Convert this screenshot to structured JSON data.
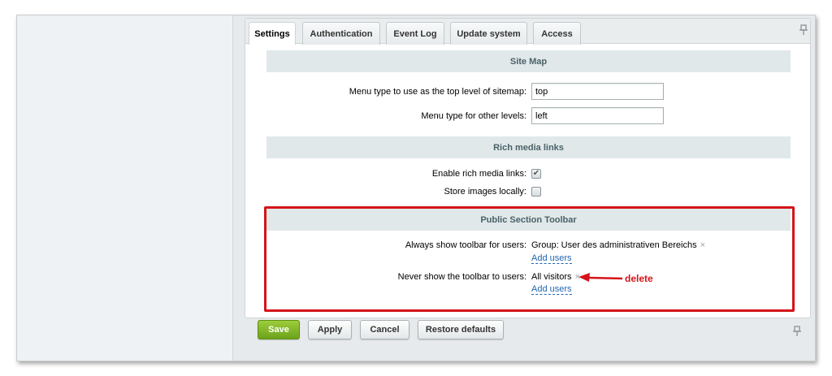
{
  "tabs": [
    {
      "label": "Settings",
      "active": true
    },
    {
      "label": "Authentication",
      "active": false
    },
    {
      "label": "Event Log",
      "active": false
    },
    {
      "label": "Update system",
      "active": false
    },
    {
      "label": "Access",
      "active": false
    }
  ],
  "site_map": {
    "header": "Site Map",
    "top_level_label": "Menu type to use as the top level of sitemap:",
    "top_level_value": "top",
    "other_levels_label": "Menu type for other levels:",
    "other_levels_value": "left"
  },
  "rich_media": {
    "header": "Rich media links",
    "enable_label": "Enable rich media links:",
    "enable_checked": true,
    "store_label": "Store images locally:",
    "store_checked": false
  },
  "public_toolbar": {
    "header": "Public Section Toolbar",
    "always_label": "Always show toolbar for users:",
    "always_value": "Group: User des administrativen Bereichs",
    "never_label": "Never show the toolbar to users:",
    "never_value": "All visitors",
    "add_users": "Add users",
    "remove_symbol": "×"
  },
  "annotation": {
    "text": "delete",
    "color": "#d4141a"
  },
  "buttons": {
    "save": "Save",
    "apply": "Apply",
    "cancel": "Cancel",
    "restore": "Restore defaults"
  },
  "icons": {
    "pin": "pin-icon",
    "check": "✔"
  },
  "colors": {
    "accent_green": "#7cb226",
    "link_blue": "#2066b0",
    "section_header_bg": "#e0e8ea"
  }
}
